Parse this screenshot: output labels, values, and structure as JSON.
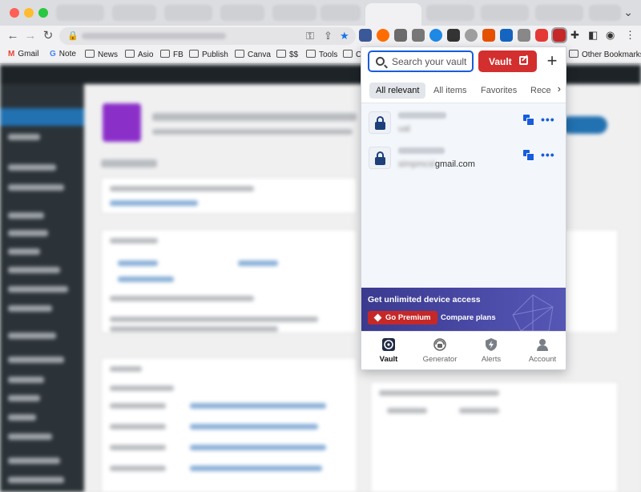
{
  "browser": {
    "bookmarks": [
      {
        "label": "Gmail",
        "icon": "gmail-icon"
      },
      {
        "label": "Note",
        "icon": "google-icon"
      },
      {
        "label": "News",
        "icon": "folder-icon"
      },
      {
        "label": "Asio",
        "icon": "folder-icon"
      },
      {
        "label": "FB",
        "icon": "folder-icon"
      },
      {
        "label": "Publish",
        "icon": "folder-icon"
      },
      {
        "label": "Canva",
        "icon": "folder-icon"
      },
      {
        "label": "$$",
        "icon": "folder-icon"
      },
      {
        "label": "Tools",
        "icon": "folder-icon"
      },
      {
        "label": "C",
        "icon": "folder-icon"
      },
      {
        "label": "Other Bookmarks",
        "icon": "folder-icon"
      }
    ]
  },
  "vault_popup": {
    "search_placeholder": "Search your vault",
    "vault_button_label": "Vault",
    "filters": [
      "All relevant",
      "All items",
      "Favorites",
      "Rece"
    ],
    "items": [
      {
        "subtitle": "ual"
      },
      {
        "subtitle_prefix": "simpmcsl",
        "subtitle_suffix": "gmail.com"
      }
    ],
    "promo": {
      "title": "Get unlimited device access",
      "premium_button": "Go Premium",
      "plans_link": "Compare plans"
    },
    "nav": [
      "Vault",
      "Generator",
      "Alerts",
      "Account"
    ],
    "colors": {
      "accent_blue": "#175ddc",
      "brand_red": "#d32f2f",
      "promo_purple": "#4b4ba8"
    }
  }
}
